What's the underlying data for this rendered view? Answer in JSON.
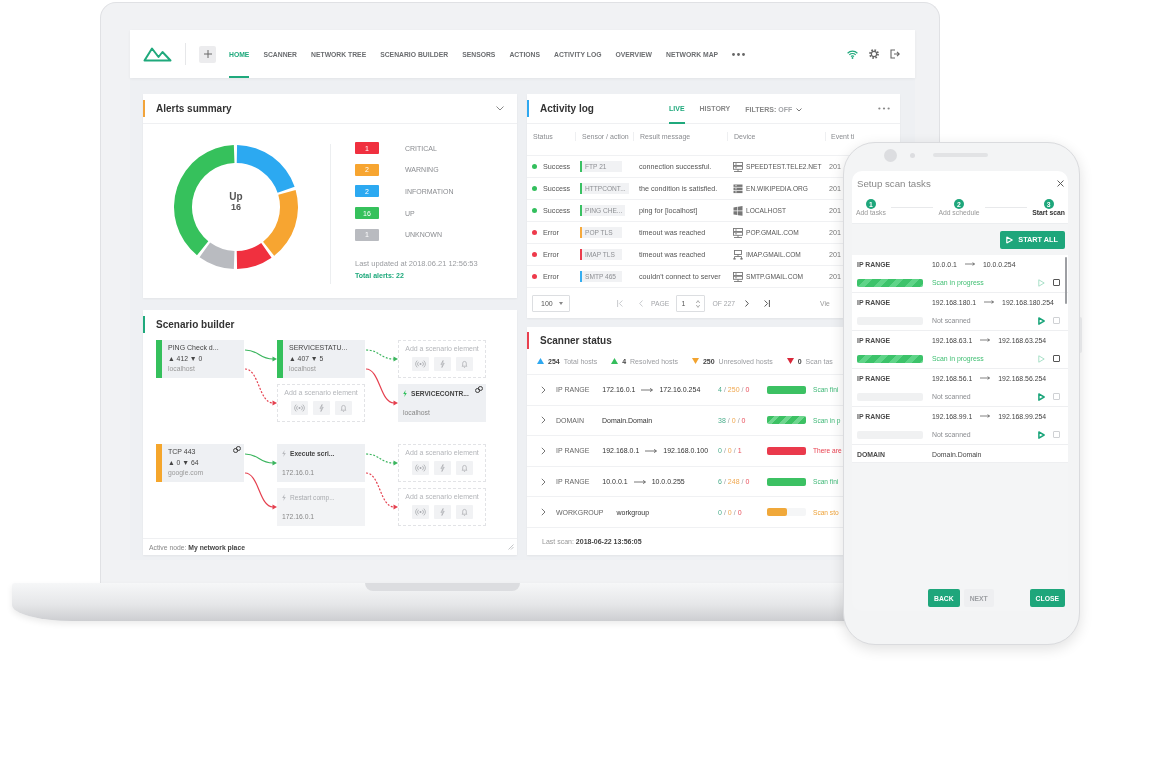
{
  "laptop": {
    "nav": {
      "tabs": [
        {
          "label": "HOME",
          "selected": true
        },
        {
          "label": "SCANNER",
          "selected": false
        },
        {
          "label": "NETWORK TREE",
          "selected": false
        },
        {
          "label": "SCENARIO BUILDER",
          "selected": false
        },
        {
          "label": "SENSORS",
          "selected": false
        },
        {
          "label": "ACTIONS",
          "selected": false
        },
        {
          "label": "ACTIVITY LOG",
          "selected": false
        },
        {
          "label": "OVERVIEW",
          "selected": false
        },
        {
          "label": "NETWORK MAP",
          "selected": false
        }
      ]
    },
    "alerts_summary": {
      "title": "Alerts summary",
      "center_label": "Up",
      "center_value": "16",
      "legend": [
        {
          "count": "1",
          "label": "CRITICAL",
          "color": "#f0303f"
        },
        {
          "count": "2",
          "label": "WARNING",
          "color": "#f7a531"
        },
        {
          "count": "2",
          "label": "INFORMATION",
          "color": "#2ca9f1"
        },
        {
          "count": "16",
          "label": "UP",
          "color": "#36c15c"
        },
        {
          "count": "1",
          "label": "UNKNOWN",
          "color": "#b9bbc0"
        }
      ],
      "last_updated": "Last updated at 2018.06.21 12:56:53",
      "total": "Total alerts: 22"
    },
    "activity_log": {
      "title": "Activity log",
      "tabs": [
        {
          "label": "LIVE",
          "selected": true
        },
        {
          "label": "HISTORY",
          "selected": false
        }
      ],
      "filters": {
        "label": "FILTERS:",
        "value": "OFF"
      },
      "columns": [
        "Status",
        "Sensor / action",
        "Result message",
        "Device",
        "Event ti"
      ],
      "rows": [
        {
          "status": {
            "label": "Success",
            "color": "#33bf5d"
          },
          "sensor": {
            "label": "FTP 21",
            "color": "#3ac163"
          },
          "message": "connection successful.",
          "device": {
            "kind": "server",
            "name": "SPEEDTEST.TELE2.NET"
          },
          "event": "201"
        },
        {
          "status": {
            "label": "Success",
            "color": "#33bf5d"
          },
          "sensor": {
            "label": "HTTPCONT...",
            "color": "#3ac163"
          },
          "message": "the condition is satisfied.",
          "device": {
            "kind": "rack",
            "name": "EN.WIKIPEDIA.ORG"
          },
          "event": "201"
        },
        {
          "status": {
            "label": "Success",
            "color": "#33bf5d"
          },
          "sensor": {
            "label": "PING CHE...",
            "color": "#3ac163"
          },
          "message": "ping for [localhost]",
          "device": {
            "kind": "windows",
            "name": "LOCALHOST"
          },
          "event": "201"
        },
        {
          "status": {
            "label": "Error",
            "color": "#ee3a4b"
          },
          "sensor": {
            "label": "POP TLS",
            "color": "#f6a93b"
          },
          "message": "timeout was reached",
          "device": {
            "kind": "server",
            "name": "POP.GMAIL.COM"
          },
          "event": "201"
        },
        {
          "status": {
            "label": "Error",
            "color": "#ee3a4b"
          },
          "sensor": {
            "label": "IMAP TLS",
            "color": "#ea3c4c"
          },
          "message": "timeout was reached",
          "device": {
            "kind": "network",
            "name": "IMAP.GMAIL.COM"
          },
          "event": "201"
        },
        {
          "status": {
            "label": "Error",
            "color": "#ee3a4b"
          },
          "sensor": {
            "label": "SMTP 465",
            "color": "#36aef0"
          },
          "message": "couldn't connect to server",
          "device": {
            "kind": "server",
            "name": "SMTP.GMAIL.COM"
          },
          "event": "201"
        }
      ],
      "pager": {
        "page_size": "100",
        "page_label": "PAGE",
        "page": "1",
        "page_count": "OF 227",
        "prev_disabled": true,
        "next_disabled": false,
        "view": "Vie"
      }
    },
    "scenario_builder": {
      "title": "Scenario builder",
      "scenarios": [
        {
          "kind": "sensor",
          "title": "PING Check d...",
          "stats": "▲ 412 ▼ 0",
          "host": "localhost",
          "color": "#35c05c",
          "linked": false,
          "success": {
            "kind": "sensor",
            "title": "SERVICESTATU...",
            "stats": "▲ 407 ▼ 5",
            "host": "localhost",
            "color": "#35c05c",
            "linked": false,
            "success": {
              "kind": "placeholder",
              "label": "Add a scenario element"
            },
            "failure": {
              "kind": "action",
              "title": "SERVICECONTR...",
              "host": "localhost",
              "linked": true,
              "active": true,
              "disabled": false
            }
          },
          "failure": {
            "kind": "placeholder",
            "label": "Add a scenario element"
          }
        },
        {
          "kind": "sensor",
          "title": "TCP 443",
          "stats": "▲ 0 ▼ 64",
          "host": "google.com",
          "color": "#f5a62c",
          "linked": true,
          "success": {
            "kind": "action",
            "title": "Execute scri...",
            "host": "172.16.0.1",
            "linked": false,
            "active": false,
            "disabled": false,
            "success": {
              "kind": "placeholder",
              "label": "Add a scenario element"
            },
            "failure": {
              "kind": "placeholder",
              "label": "Add a scenario element"
            }
          },
          "failure": {
            "kind": "action",
            "title": "Restart comp...",
            "host": "172.16.0.1",
            "linked": false,
            "active": false,
            "disabled": true
          }
        }
      ],
      "active_node": "Active node: **My network place**"
    },
    "scanner_status": {
      "title": "Scanner status",
      "summary": [
        {
          "kind": "up",
          "value": "254",
          "label": "Total hosts",
          "color": "#2ea8f0"
        },
        {
          "kind": "up",
          "value": "4",
          "label": "Resolved hosts",
          "color": "#34be5c"
        },
        {
          "kind": "down",
          "value": "250",
          "label": "Unresolved hosts",
          "color": "#f2a32f"
        },
        {
          "kind": "down",
          "value": "0",
          "label": "Scan tas",
          "color": "#d9283a"
        }
      ],
      "rows": [
        {
          "kind": "range",
          "type": "IP RANGE",
          "from": "172.16.0.1",
          "to": "172.16.0.254",
          "counts": [
            "4",
            "/",
            "250",
            "/",
            "0"
          ],
          "level": 1,
          "status": {
            "kind": "finished",
            "label": "Scan fini"
          },
          "expanded": false
        },
        {
          "kind": "single",
          "type": "DOMAIN",
          "value": "Domain.Domain",
          "counts": [
            "38",
            "/",
            "0",
            "/",
            "0"
          ],
          "level": 1,
          "status": {
            "kind": "in_progress",
            "label": "Scan in p"
          },
          "expanded": false
        },
        {
          "kind": "range",
          "type": "IP RANGE",
          "from": "192.168.0.1",
          "to": "192.168.0.100",
          "counts": [
            "0",
            "/",
            "0",
            "/",
            "1"
          ],
          "level": 1,
          "status": {
            "kind": "error",
            "label": "There are"
          },
          "expanded": false
        },
        {
          "kind": "range",
          "type": "IP RANGE",
          "from": "10.0.0.1",
          "to": "10.0.0.255",
          "counts": [
            "6",
            "/",
            "248",
            "/",
            "0"
          ],
          "level": 1,
          "status": {
            "kind": "finished",
            "label": "Scan fini"
          },
          "expanded": false
        },
        {
          "kind": "single",
          "type": "WORKGROUP",
          "value": "workgroup",
          "counts": [
            "0",
            "/",
            "0",
            "/",
            "0"
          ],
          "level": 0.5,
          "status": {
            "kind": "stopped",
            "label": "Scan sto"
          },
          "expanded": false
        }
      ],
      "last_scan": "Last scan: **2018-06-22 13:56:05**"
    }
  },
  "phone": {
    "title": "Setup scan tasks",
    "steps": [
      {
        "number": "1",
        "label": "Add tasks",
        "selected": false
      },
      {
        "number": "2",
        "label": "Add schedule",
        "selected": false
      },
      {
        "number": "3",
        "label": "Start scan",
        "selected": true
      }
    ],
    "start_all": "START ALL",
    "tasks": [
      {
        "kind": "range",
        "type": "IP RANGE",
        "from": "10.0.0.1",
        "to": "10.0.0.254",
        "level": 1,
        "status": {
          "kind": "in_progress",
          "label": "Scan in progress"
        },
        "checkbox": {
          "checked": false,
          "disabled": false
        }
      },
      {
        "kind": "range",
        "type": "IP RANGE",
        "from": "192.168.180.1",
        "to": "192.168.180.254",
        "level": 0,
        "status": {
          "kind": "not_scanned",
          "label": "Not scanned"
        },
        "checkbox": {
          "checked": false,
          "disabled": true
        }
      },
      {
        "kind": "range",
        "type": "IP RANGE",
        "from": "192.168.63.1",
        "to": "192.168.63.254",
        "level": 1,
        "status": {
          "kind": "in_progress",
          "label": "Scan in progress"
        },
        "checkbox": {
          "checked": false,
          "disabled": false
        }
      },
      {
        "kind": "range",
        "type": "IP RANGE",
        "from": "192.168.56.1",
        "to": "192.168.56.254",
        "level": 0,
        "status": {
          "kind": "not_scanned",
          "label": "Not scanned"
        },
        "checkbox": {
          "checked": false,
          "disabled": true
        }
      },
      {
        "kind": "range",
        "type": "IP RANGE",
        "from": "192.168.99.1",
        "to": "192.168.99.254",
        "level": 0,
        "status": {
          "kind": "not_scanned",
          "label": "Not scanned"
        },
        "checkbox": {
          "checked": false,
          "disabled": true
        }
      },
      {
        "kind": "single",
        "type": "DOMAIN",
        "value": "Domain.Domain"
      }
    ],
    "buttons": [
      {
        "label": "BACK",
        "disabled": false
      },
      {
        "label": "NEXT",
        "disabled": true
      },
      {
        "label": "CLOSE",
        "disabled": false
      }
    ]
  }
}
